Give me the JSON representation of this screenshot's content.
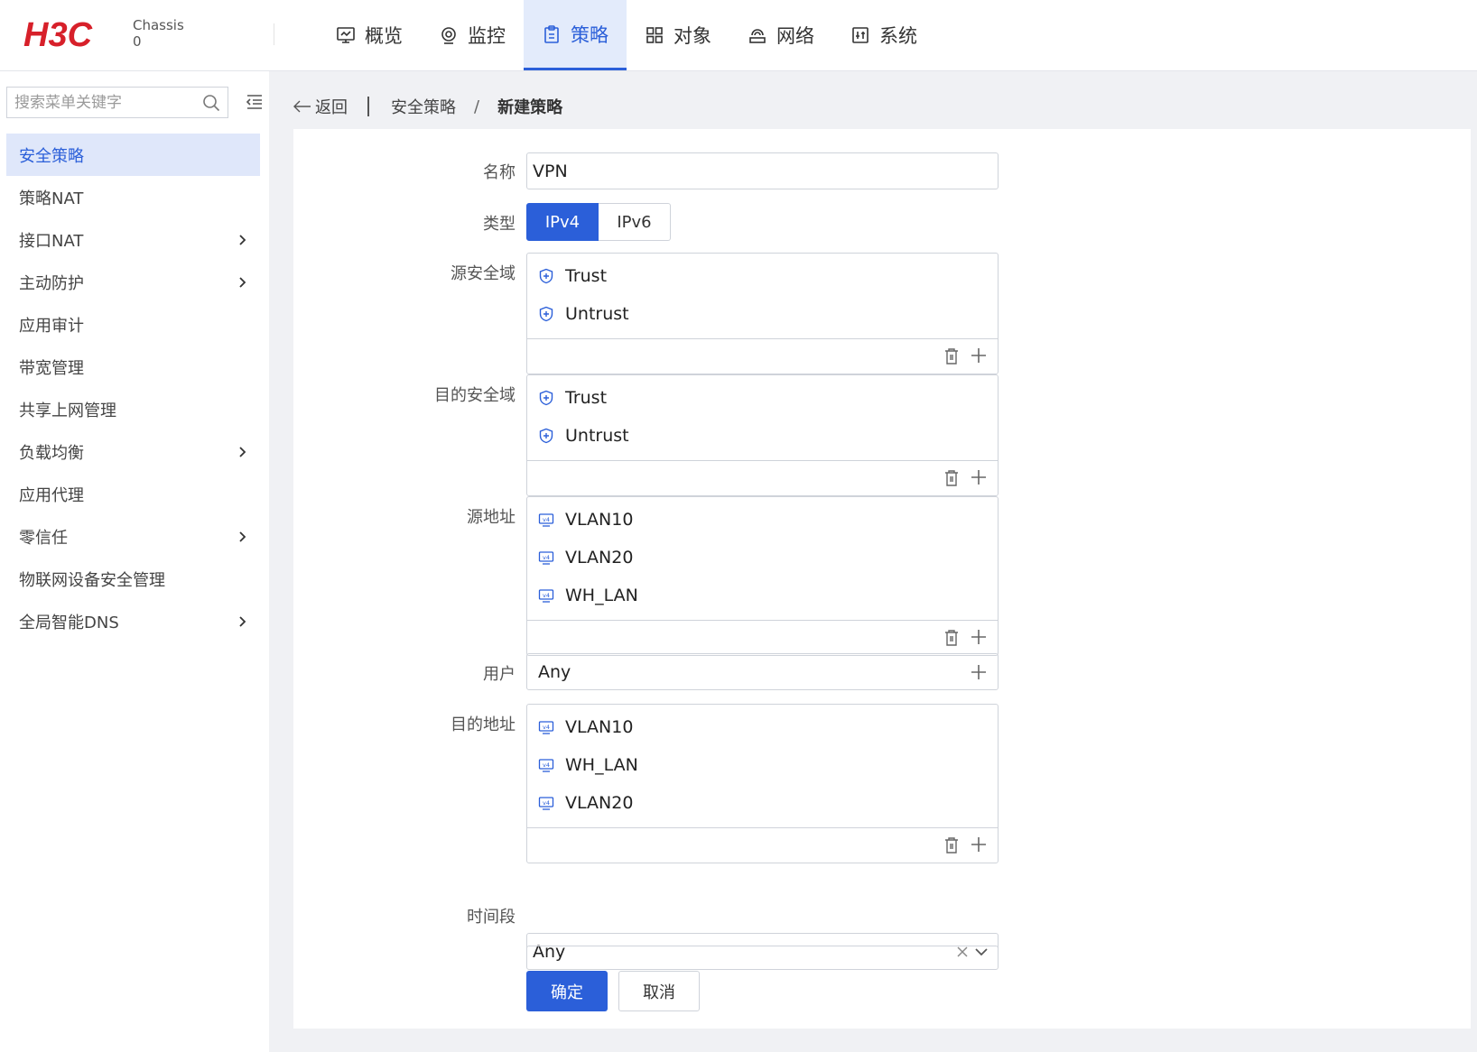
{
  "header": {
    "logo_text": "H3C",
    "chassis_label": "Chassis",
    "chassis_value": "0",
    "nav": [
      {
        "label": "概览",
        "icon": "monitor-icon",
        "active": false
      },
      {
        "label": "监控",
        "icon": "camera-icon",
        "active": false
      },
      {
        "label": "策略",
        "icon": "clipboard-icon",
        "active": true
      },
      {
        "label": "对象",
        "icon": "grid-icon",
        "active": false
      },
      {
        "label": "网络",
        "icon": "network-icon",
        "active": false
      },
      {
        "label": "系统",
        "icon": "system-icon",
        "active": false
      }
    ]
  },
  "sidebar": {
    "search_placeholder": "搜索菜单关键字",
    "items": [
      {
        "label": "安全策略",
        "active": true,
        "expandable": false
      },
      {
        "label": "策略NAT",
        "active": false,
        "expandable": false
      },
      {
        "label": "接口NAT",
        "active": false,
        "expandable": true
      },
      {
        "label": "主动防护",
        "active": false,
        "expandable": true
      },
      {
        "label": "应用审计",
        "active": false,
        "expandable": false
      },
      {
        "label": "带宽管理",
        "active": false,
        "expandable": false
      },
      {
        "label": "共享上网管理",
        "active": false,
        "expandable": false
      },
      {
        "label": "负载均衡",
        "active": false,
        "expandable": true
      },
      {
        "label": "应用代理",
        "active": false,
        "expandable": false
      },
      {
        "label": "零信任",
        "active": false,
        "expandable": true
      },
      {
        "label": "物联网设备安全管理",
        "active": false,
        "expandable": false
      },
      {
        "label": "全局智能DNS",
        "active": false,
        "expandable": true
      }
    ]
  },
  "breadcrumb": {
    "back": "返回",
    "parent": "安全策略",
    "separator": "/",
    "current": "新建策略"
  },
  "form": {
    "name": {
      "label": "名称",
      "value": "VPN"
    },
    "type": {
      "label": "类型",
      "options": [
        "IPv4",
        "IPv6"
      ],
      "selected": "IPv4"
    },
    "src_zone": {
      "label": "源安全域",
      "items": [
        "Trust",
        "Untrust"
      ]
    },
    "dst_zone": {
      "label": "目的安全域",
      "items": [
        "Trust",
        "Untrust"
      ]
    },
    "src_addr": {
      "label": "源地址",
      "items": [
        "VLAN10",
        "VLAN20",
        "WH_LAN"
      ]
    },
    "user": {
      "label": "用户",
      "value": "Any"
    },
    "dst_addr": {
      "label": "目的地址",
      "items": [
        "VLAN10",
        "WH_LAN",
        "VLAN20"
      ]
    },
    "time_range": {
      "label": "时间段",
      "value": "Any"
    }
  },
  "buttons": {
    "ok": "确定",
    "cancel": "取消"
  },
  "colors": {
    "accent": "#2b5fd9",
    "active_bg": "#dfe7fa"
  }
}
